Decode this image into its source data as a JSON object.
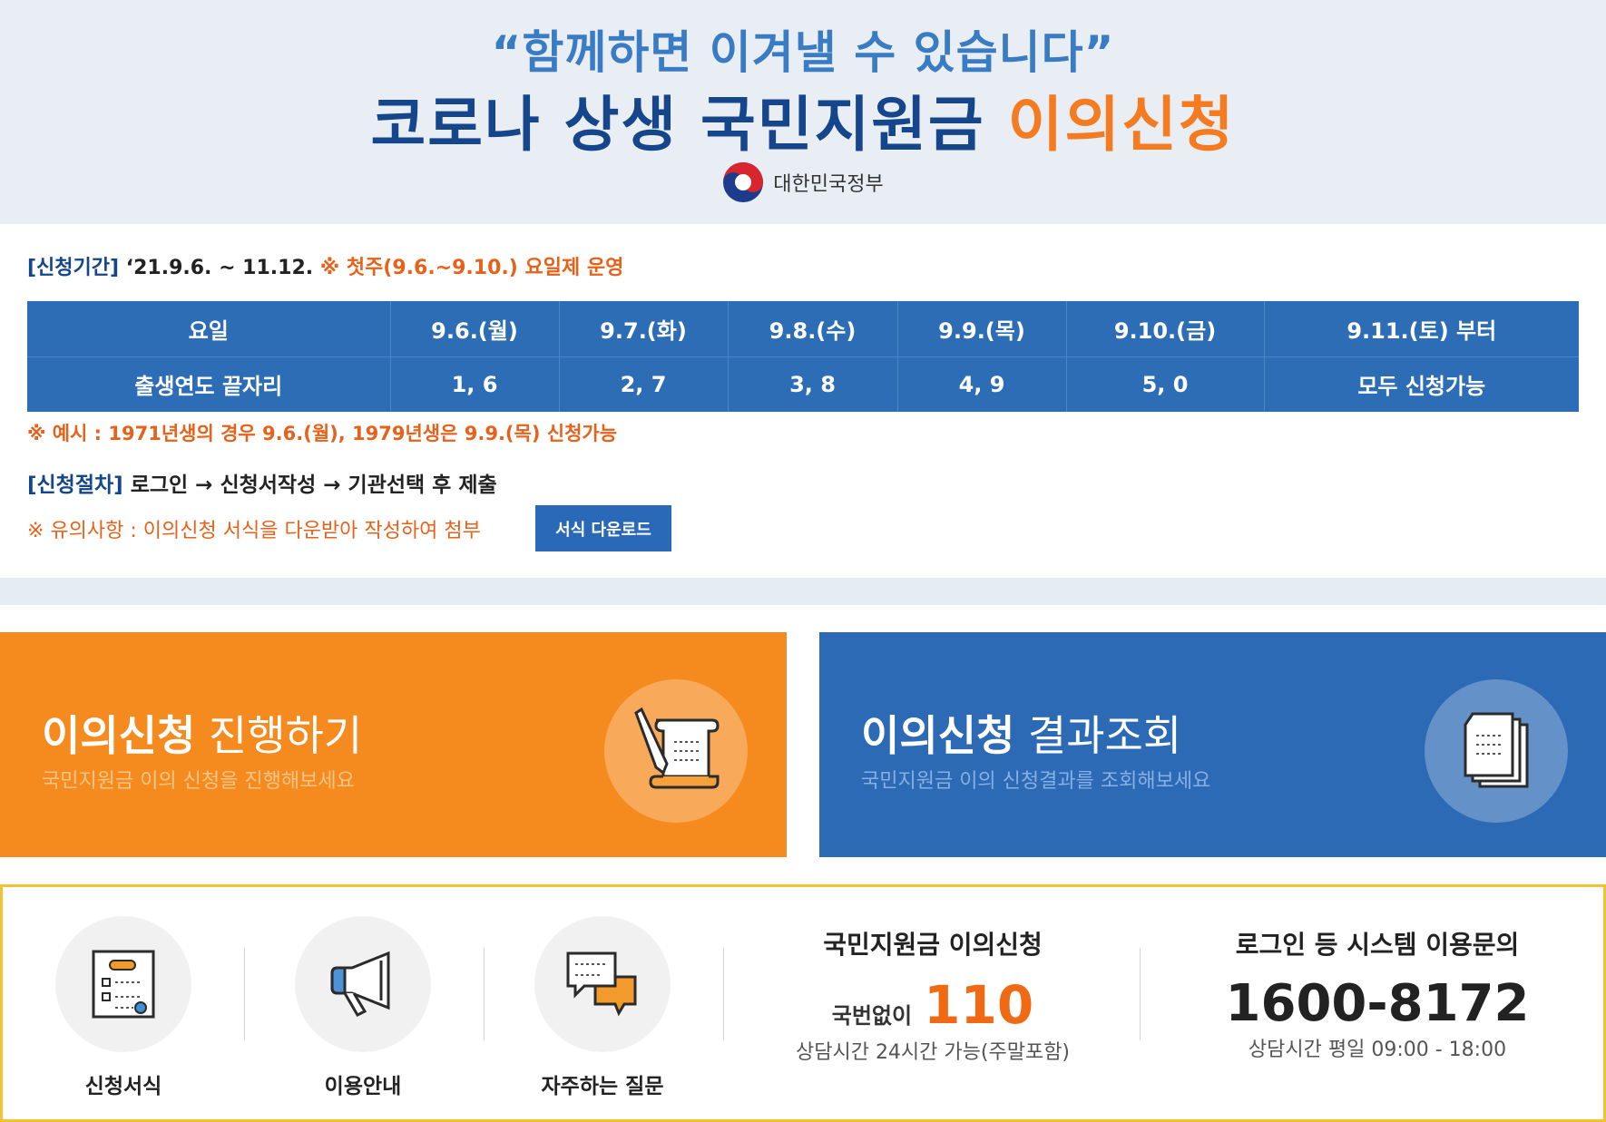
{
  "header": {
    "slogan": "“함께하면 이겨낼 수 있습니다”",
    "title_main": "코로나 상생 국민지원금 ",
    "title_accent": "이의신청",
    "gov_name": "대한민국정부"
  },
  "period": {
    "label": "[신청기간]",
    "dates": "‘21.9.6. ~ 11.12.",
    "note": "※ 첫주(9.6.~9.10.) 요일제 운영"
  },
  "schedule": {
    "header": [
      "요일",
      "9.6.(월)",
      "9.7.(화)",
      "9.8.(수)",
      "9.9.(목)",
      "9.10.(금)",
      "9.11.(토) 부터"
    ],
    "row": [
      "출생연도 끝자리",
      "1, 6",
      "2, 7",
      "3, 8",
      "4, 9",
      "5, 0",
      "모두 신청가능"
    ]
  },
  "example_note": "※ 예시 : 1971년생의 경우 9.6.(월), 1979년생은 9.9.(목) 신청가능",
  "procedure": {
    "label": "[신청절차]",
    "steps": "로그인 → 신청서작성 → 기관선택 후 제출"
  },
  "notice": {
    "text": "※ 유의사항 : 이의신청 서식을 다운받아 작성하여 첨부",
    "download_label": "서식 다운로드"
  },
  "cards": {
    "apply": {
      "title_bold": "이의신청",
      "title_light": " 진행하기",
      "subtitle": "국민지원금 이의 신청을 진행해보세요"
    },
    "result": {
      "title_bold": "이의신청",
      "title_light": " 결과조회",
      "subtitle": "국민지원금 이의 신청결과를 조회해보세요"
    }
  },
  "services": [
    {
      "label": "신청서식",
      "icon": "form-icon"
    },
    {
      "label": "이용안내",
      "icon": "megaphone-icon"
    },
    {
      "label": "자주하는 질문",
      "icon": "chat-bubbles-icon"
    }
  ],
  "contact_objection": {
    "title": "국민지원금 이의신청",
    "prefix": "국번없이",
    "number": "110",
    "hours": "상담시간 24시간 가능(주말포함)"
  },
  "contact_system": {
    "title": "로그인 등 시스템 이용문의",
    "number": "1600-8172",
    "hours": "상담시간 평일 09:00 - 18:00"
  },
  "colors": {
    "navy": "#15458a",
    "orange": "#f47b20",
    "table_blue": "#2d6db5",
    "card_orange": "#f58b1f",
    "card_blue": "#2d6ab5",
    "border_yellow": "#f1c232"
  }
}
